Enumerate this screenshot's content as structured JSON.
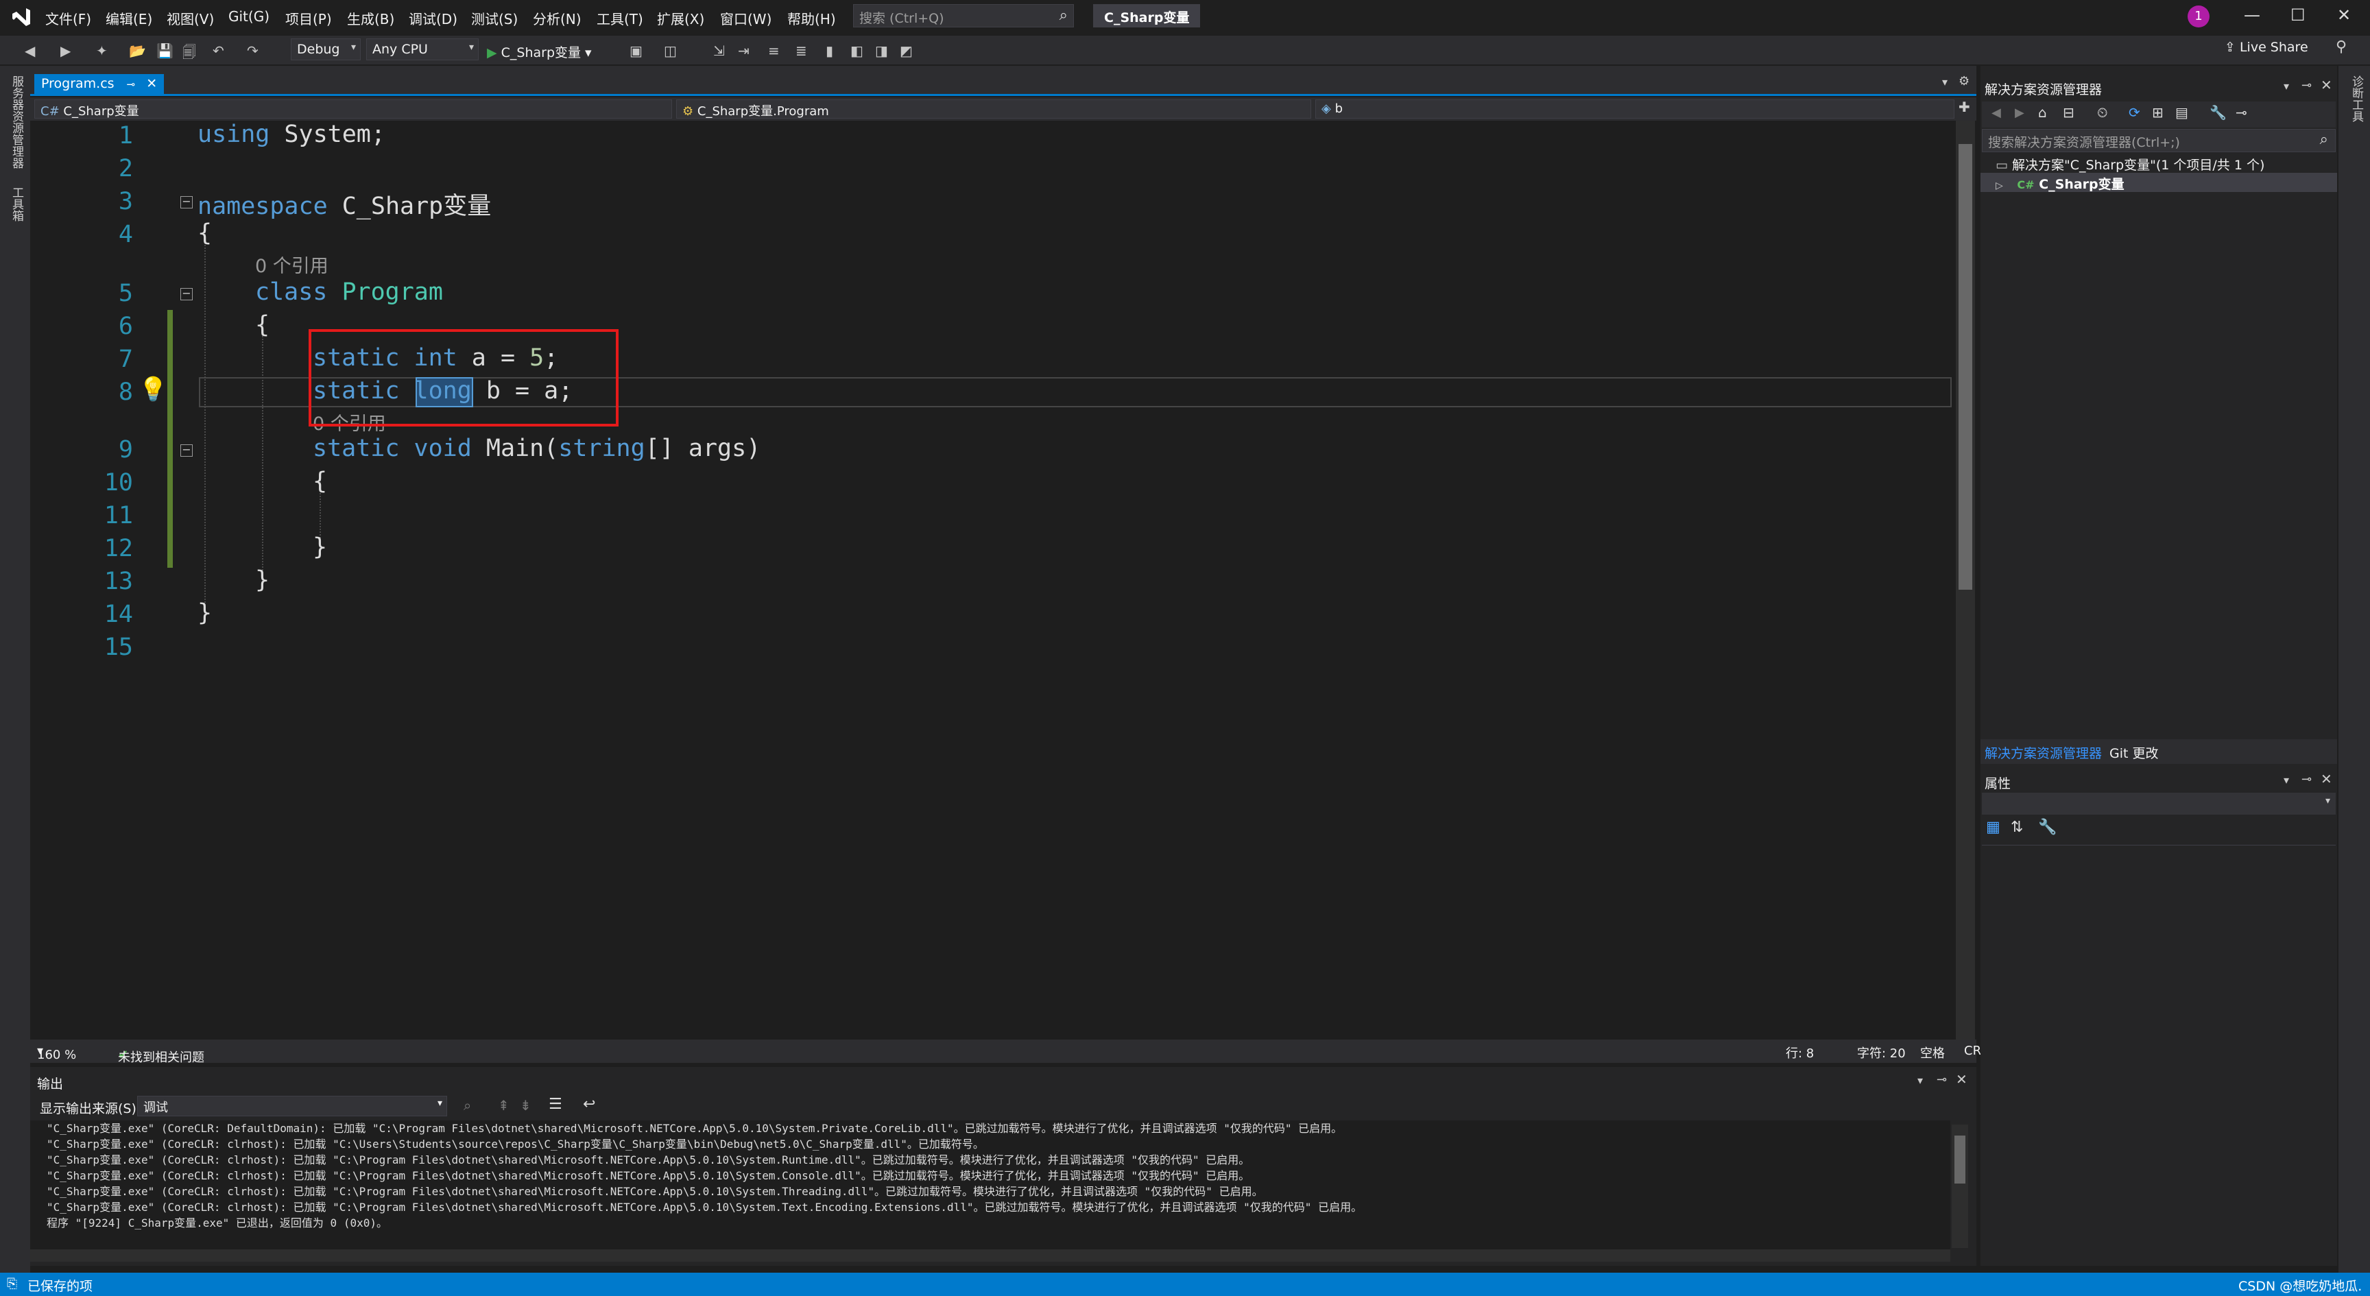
{
  "titlebar": {
    "menu": [
      "文件(F)",
      "编辑(E)",
      "视图(V)",
      "Git(G)",
      "项目(P)",
      "生成(B)",
      "调试(D)",
      "测试(S)",
      "分析(N)",
      "工具(T)",
      "扩展(X)",
      "窗口(W)",
      "帮助(H)"
    ],
    "search_placeholder": "搜索 (Ctrl+Q)",
    "solution_name": "C_Sharp变量",
    "account_badge": "1"
  },
  "toolbar": {
    "configuration": "Debug",
    "platform": "Any CPU",
    "start_target": "C_Sharp变量",
    "live_share": "Live Share"
  },
  "left_strip": {
    "tabs": [
      "服务器资源管理器",
      "工具箱"
    ]
  },
  "right_strip": {
    "tabs": [
      "诊断工具"
    ]
  },
  "editor": {
    "tab_label": "Program.cs",
    "nav": {
      "project": "C_Sharp变量",
      "type": "C_Sharp变量.Program",
      "member": "b"
    },
    "line_numbers": [
      "1",
      "2",
      "3",
      "4",
      "5",
      "6",
      "7",
      "8",
      "9",
      "10",
      "11",
      "12",
      "13",
      "14",
      "15"
    ],
    "lines": {
      "l1_kw": "using",
      "l1_rest": " System;",
      "l3_kw": "namespace",
      "l3_rest": " C_Sharp变量",
      "l4": "{",
      "hint_refs_class": "0 个引用",
      "l5_kw": "class",
      "l5_type": "Program",
      "l6": "{",
      "l7_kw1": "static",
      "l7_kw2": "int",
      "l7_rest": " a = ",
      "l7_num": "5",
      "l7_end": ";",
      "l8_kw1": "static",
      "l8_kw2": "long",
      "l8_rest": " b = a;",
      "hint_refs_main": "0 个引用",
      "l9_kw1": "static",
      "l9_kw2": "void",
      "l9_name": " Main(",
      "l9_kw3": "string",
      "l9_rest": "[] args)",
      "l10": "{",
      "l12": "}",
      "l13": "}",
      "l14": "}"
    },
    "status": {
      "zoom": "160 %",
      "issues": "未找到相关问题",
      "line": "行: 8",
      "column": "字符: 20",
      "whitespace": "空格",
      "line_ending": "CRLF"
    }
  },
  "output": {
    "title": "输出",
    "source_label": "显示输出来源(S):",
    "source_value": "调试",
    "lines": [
      "\"C_Sharp变量.exe\" (CoreCLR: DefaultDomain): 已加载 \"C:\\Program Files\\dotnet\\shared\\Microsoft.NETCore.App\\5.0.10\\System.Private.CoreLib.dll\"。已跳过加载符号。模块进行了优化，并且调试器选项 \"仅我的代码\" 已启用。",
      "\"C_Sharp变量.exe\" (CoreCLR: clrhost): 已加载 \"C:\\Users\\Students\\source\\repos\\C_Sharp变量\\C_Sharp变量\\bin\\Debug\\net5.0\\C_Sharp变量.dll\"。已加载符号。",
      "\"C_Sharp变量.exe\" (CoreCLR: clrhost): 已加载 \"C:\\Program Files\\dotnet\\shared\\Microsoft.NETCore.App\\5.0.10\\System.Runtime.dll\"。已跳过加载符号。模块进行了优化，并且调试器选项 \"仅我的代码\" 已启用。",
      "\"C_Sharp变量.exe\" (CoreCLR: clrhost): 已加载 \"C:\\Program Files\\dotnet\\shared\\Microsoft.NETCore.App\\5.0.10\\System.Console.dll\"。已跳过加载符号。模块进行了优化，并且调试器选项 \"仅我的代码\" 已启用。",
      "\"C_Sharp变量.exe\" (CoreCLR: clrhost): 已加载 \"C:\\Program Files\\dotnet\\shared\\Microsoft.NETCore.App\\5.0.10\\System.Threading.dll\"。已跳过加载符号。模块进行了优化，并且调试器选项 \"仅我的代码\" 已启用。",
      "\"C_Sharp变量.exe\" (CoreCLR: clrhost): 已加载 \"C:\\Program Files\\dotnet\\shared\\Microsoft.NETCore.App\\5.0.10\\System.Text.Encoding.Extensions.dll\"。已跳过加载符号。模块进行了优化，并且调试器选项 \"仅我的代码\" 已启用。",
      "程序 \"[9224] C_Sharp变量.exe\" 已退出，返回值为 0 (0x0)。"
    ]
  },
  "solution_explorer": {
    "title": "解决方案资源管理器",
    "search_placeholder": "搜索解决方案资源管理器(Ctrl+;)",
    "solution_node": "解决方案\"C_Sharp变量\"(1 个项目/共 1 个)",
    "project_node": "C_Sharp变量",
    "tabs": [
      "解决方案资源管理器",
      "Git 更改"
    ]
  },
  "properties": {
    "title": "属性"
  },
  "statusbar": {
    "message": "已保存的项",
    "watermark": "CSDN @想吃奶地瓜."
  },
  "colors": {
    "accent": "#007acc",
    "keyword": "#569cd6",
    "type": "#4ec9b0",
    "number": "#b5cea8",
    "annotation_box": "#e51a1a"
  }
}
